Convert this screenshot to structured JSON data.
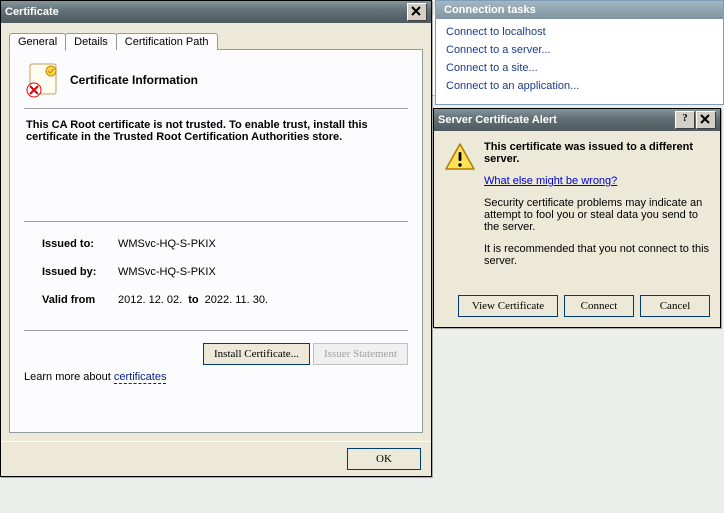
{
  "bg": {
    "panel_title": "Connection tasks",
    "items": [
      "Connect to localhost",
      "Connect to a server...",
      "Connect to a site...",
      "Connect to an application..."
    ]
  },
  "cert": {
    "title": "Certificate",
    "tabs": {
      "general": "General",
      "details": "Details",
      "path": "Certification Path"
    },
    "heading": "Certificate Information",
    "warning": "This CA Root certificate is not trusted. To enable trust, install this certificate in the Trusted Root Certification Authorities store.",
    "issued_to_label": "Issued to:",
    "issued_to": "WMSvc-HQ-S-PKIX",
    "issued_by_label": "Issued by:",
    "issued_by": "WMSvc-HQ-S-PKIX",
    "valid_label": "Valid from",
    "valid_from": "2012. 12. 02.",
    "valid_to_label": "to",
    "valid_to": "2022. 11. 30.",
    "install_btn": "Install Certificate...",
    "issuer_btn": "Issuer Statement",
    "learn_prefix": "Learn more about ",
    "learn_link": "certificates",
    "ok": "OK"
  },
  "alert": {
    "title": "Server Certificate Alert",
    "heading": "This certificate was issued to a different server.",
    "link": "What else might be wrong?",
    "p1": "Security certificate problems may indicate an attempt to fool you or steal data you send to the server.",
    "p2": "It is recommended that you not connect to this server.",
    "view": "View Certificate",
    "connect": "Connect",
    "cancel": "Cancel"
  }
}
